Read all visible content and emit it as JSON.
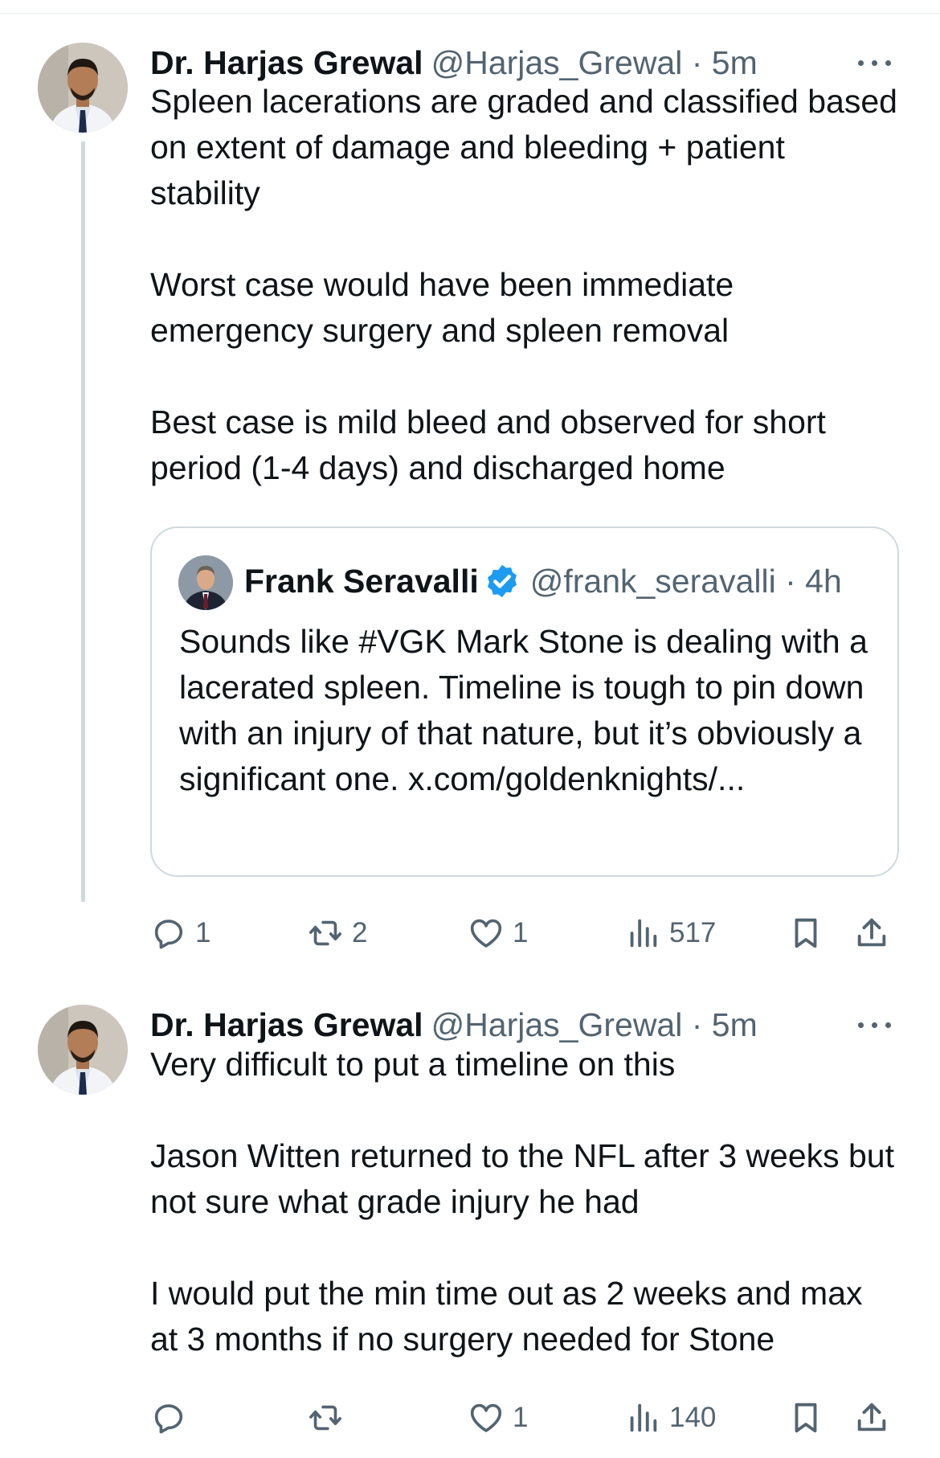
{
  "tweets": [
    {
      "author": "Dr. Harjas Grewal",
      "handle": "@Harjas_Grewal",
      "time": "· 5m",
      "avatar_icon": "doctor-avatar",
      "paragraphs": [
        "Spleen lacerations are graded and classified based on extent of damage and bleeding + patient stability",
        "",
        "Worst case would have been immediate emergency surgery and spleen removal",
        "",
        "Best case is mild bleed and observed for short period (1-4 days) and discharged home"
      ],
      "quote": {
        "author": "Frank Seravalli",
        "verified": true,
        "handle": "@frank_seravalli",
        "time": "· 4h",
        "text": "Sounds like #VGK Mark Stone is dealing with a lacerated spleen. Timeline is tough to pin down with an injury of that nature, but it’s obviously a significant one. x.com/goldenknights/..."
      },
      "actions": {
        "replies": "1",
        "reposts": "2",
        "likes": "1",
        "views": "517"
      }
    },
    {
      "author": "Dr. Harjas Grewal",
      "handle": "@Harjas_Grewal",
      "time": "· 5m",
      "avatar_icon": "doctor-avatar",
      "paragraphs": [
        "Very difficult to put a timeline on this",
        "",
        "Jason Witten returned to the NFL after 3 weeks but not sure what grade injury he had",
        "",
        "I would put the min time out as 2 weeks and max at 3 months if no surgery needed for Stone"
      ],
      "actions": {
        "replies": "",
        "reposts": "",
        "likes": "1",
        "views": "140"
      }
    }
  ],
  "colors": {
    "text": "#0f1419",
    "secondary": "#536471",
    "border": "#cfd9de",
    "verified": "#1d9bf0"
  },
  "icons": [
    "more-icon",
    "reply-icon",
    "repost-icon",
    "like-icon",
    "views-icon",
    "bookmark-icon",
    "share-icon",
    "verified-badge-icon"
  ]
}
